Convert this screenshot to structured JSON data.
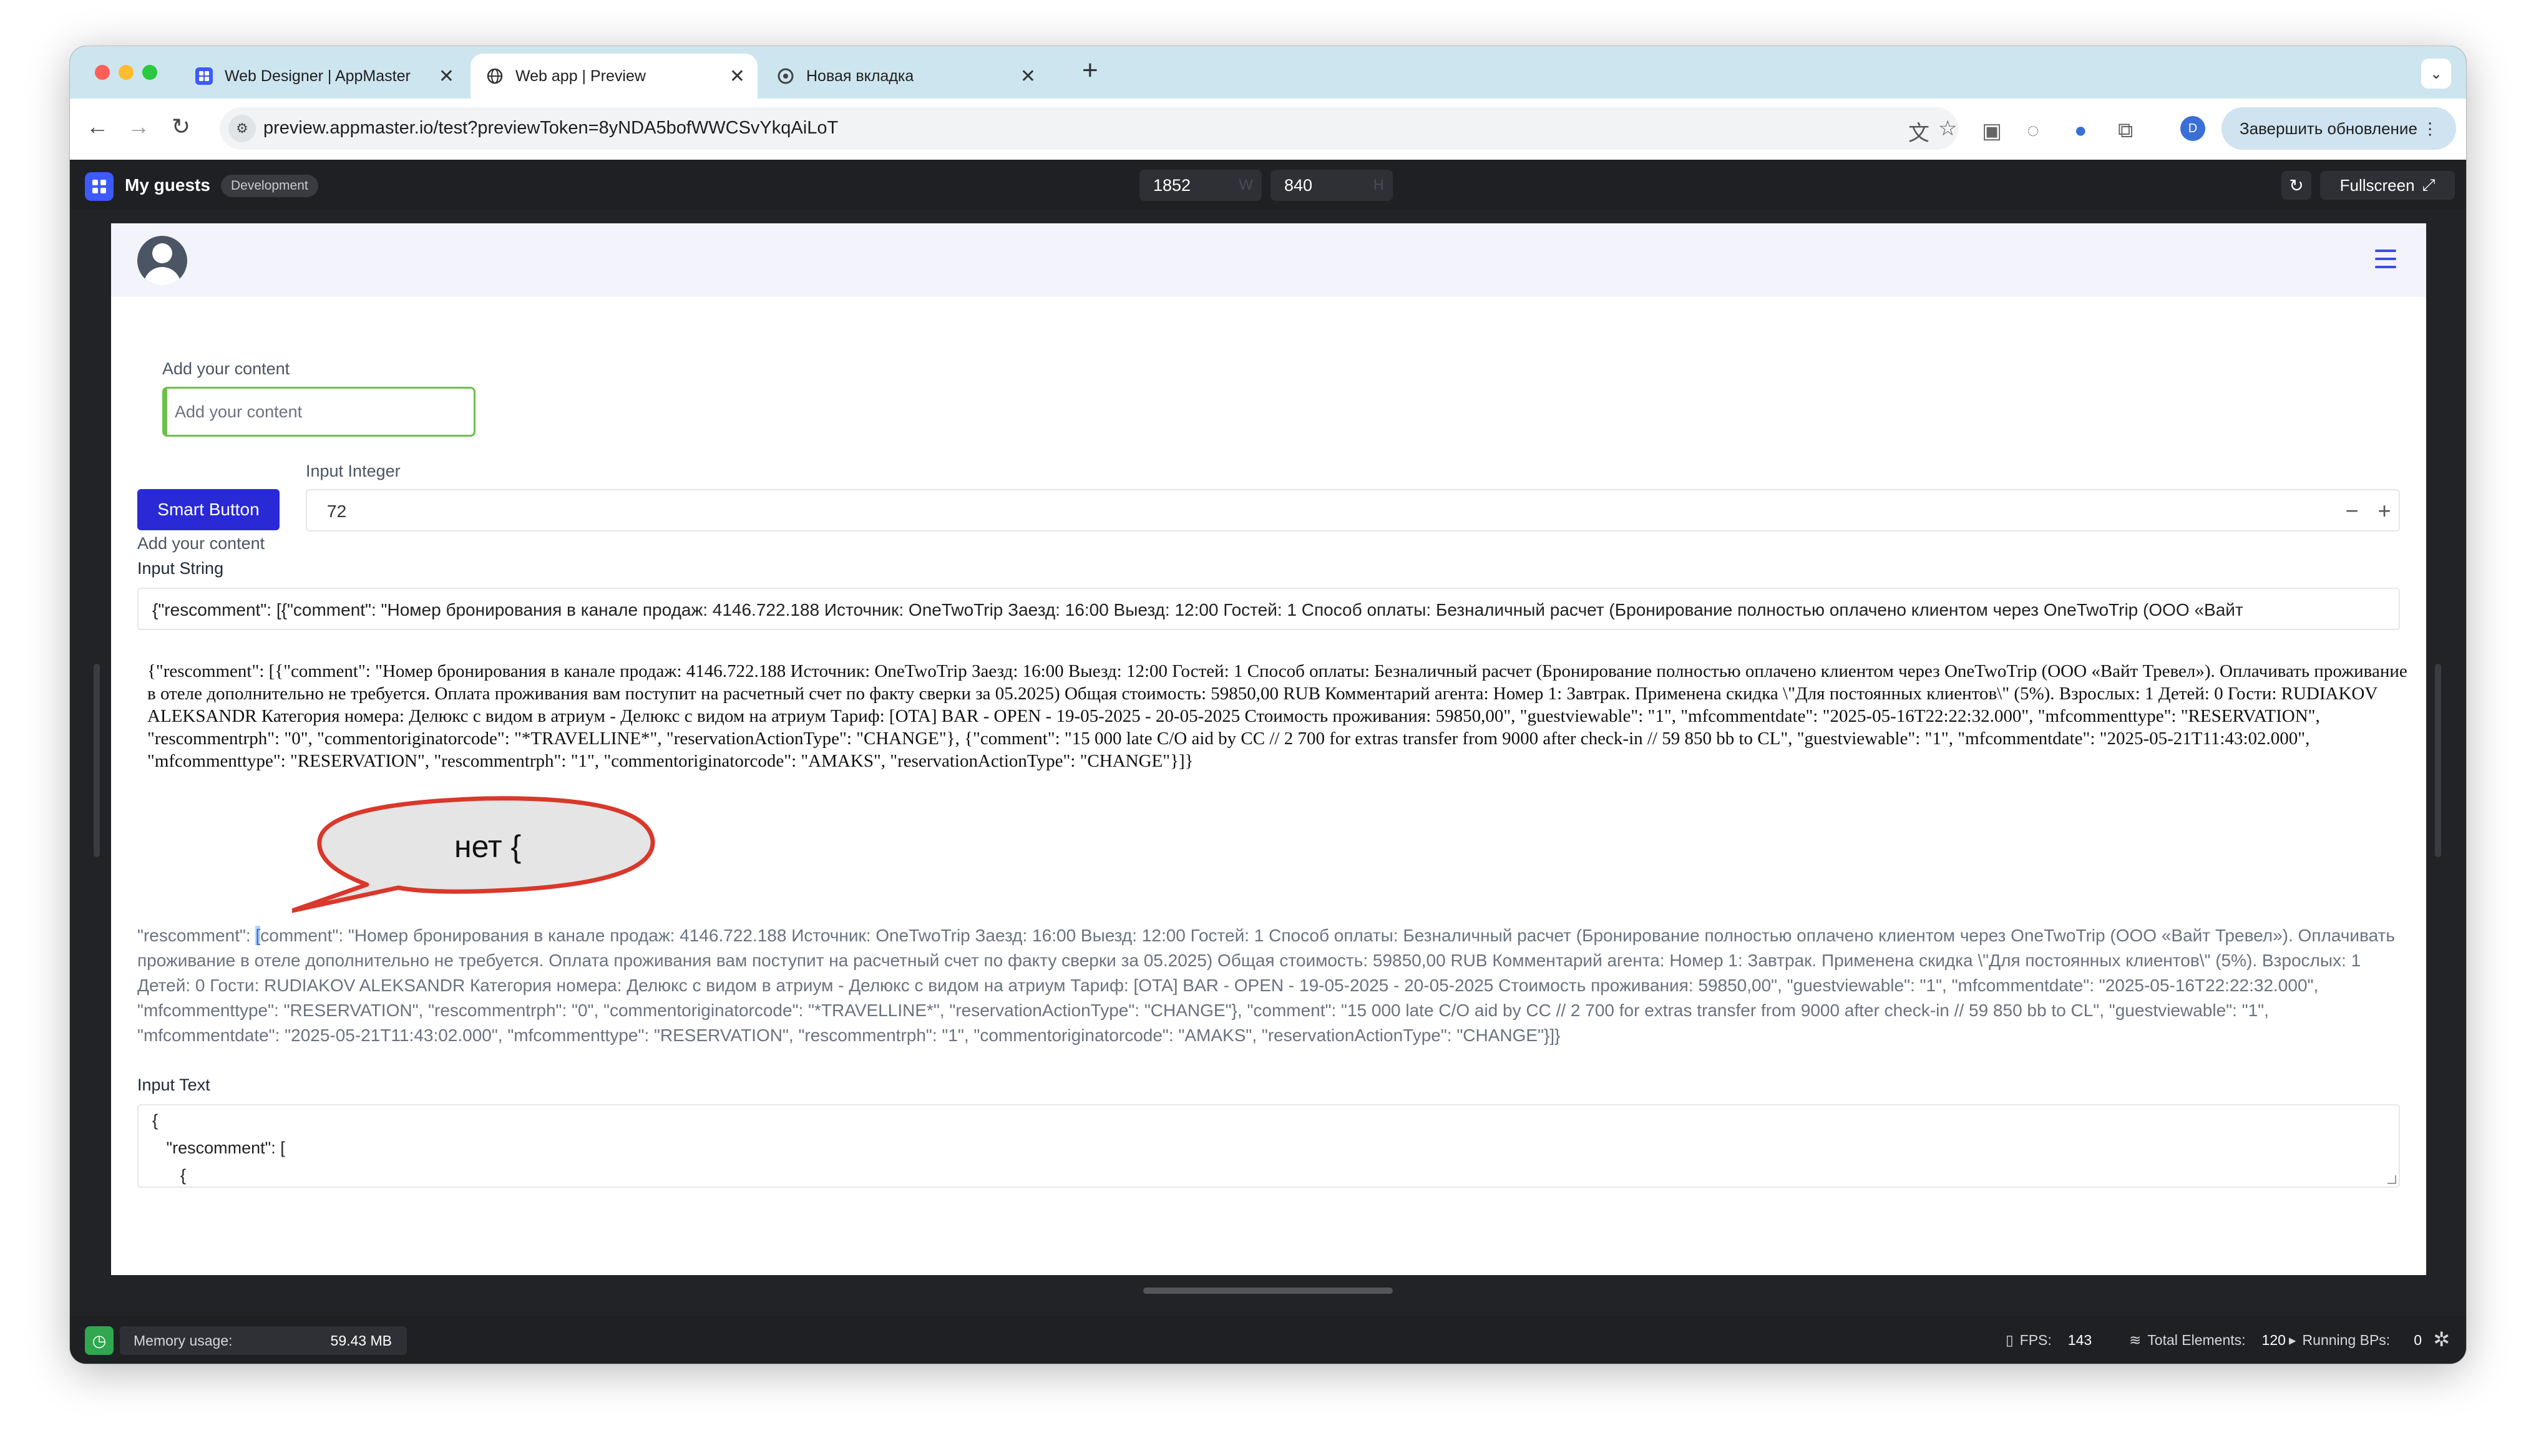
{
  "browser": {
    "tabs": [
      {
        "title": "Web Designer | AppMaster",
        "close": "✕"
      },
      {
        "title": "Web app | Preview",
        "close": "✕"
      },
      {
        "title": "Новая вкладка",
        "close": "✕"
      }
    ],
    "new_tab": "+",
    "url": "preview.appmaster.io/test?previewToken=8yNDA5bofWWCSvYkqAiLoT",
    "profile_initial": "D",
    "update_button": "Завершить обновление ⋮"
  },
  "preview_bar": {
    "app_name": "My guests",
    "env_badge": "Development",
    "width_value": "1852",
    "width_unit": "W",
    "height_value": "840",
    "height_unit": "H",
    "fullscreen_label": "Fullscreen"
  },
  "page": {
    "content_label": "Add your content",
    "content_placeholder": "Add your content",
    "smart_button": "Smart Button",
    "smart_caption": "Add your content",
    "input_integer_label": "Input Integer",
    "input_integer_value": "72",
    "stepper_minus": "−",
    "stepper_plus": "+",
    "input_string_label": "Input String",
    "input_string_value": "{\"rescomment\": [{\"comment\": \"Номер бронирования в канале продаж: 4146.722.188 Источник: OneTwoTrip Заезд: 16:00 Выезд: 12:00 Гостей: 1 Способ оплаты: Безналичный расчет (Бронирование полностью оплачено клиентом через OneTwoTrip (ООО «Вайт",
    "serif_text": "{\"rescomment\": [{\"comment\": \"Номер бронирования в канале продаж: 4146.722.188 Источник: OneTwoTrip Заезд: 16:00 Выезд: 12:00 Гостей: 1 Способ оплаты: Безналичный расчет (Бронирование полностью оплачено клиентом через OneTwoTrip (ООО «Вайт Тревел»). Оплачивать проживание в отеле дополнительно не требуется. Оплата проживания вам поступит на расчетный счет по факту сверки за 05.2025) Общая стоимость: 59850,00 RUB Комментарий агента: Номер 1: Завтрак. Применена скидка \\\"Для постоянных клиентов\\\" (5%). Взрослых: 1 Детей: 0 Гости: RUDIAKOV ALEKSANDR Категория номера: Делюкс с видом в атриум - Делюкс с видом на атриум Тариф: [OTA] BAR - OPEN - 19-05-2025 - 20-05-2025 Стоимость проживания: 59850,00\", \"guestviewable\": \"1\", \"mfcommentdate\": \"2025-05-16T22:22:32.000\", \"mfcommenttype\": \"RESERVATION\", \"rescommentrph\": \"0\", \"commentoriginatorcode\": \"*TRAVELLINE*\", \"reservationActionType\": \"CHANGE\"}, {\"comment\": \"15 000 late C/O aid by CC // 2 700 for extras transfer from 9000 after check-in // 59 850 bb to CL\", \"guestviewable\": \"1\", \"mfcommentdate\": \"2025-05-21T11:43:02.000\", \"mfcommenttype\": \"RESERVATION\", \"rescommentrph\": \"1\", \"commentoriginatorcode\": \"AMAKS\", \"reservationActionType\": \"CHANGE\"}]}",
    "callout_text": "нет {",
    "plain_text_prefix": "\"rescomment\": ",
    "plain_text_caret": "[",
    "plain_text_rest": "comment\": \"Номер бронирования в канале продаж: 4146.722.188 Источник: OneTwoTrip Заезд: 16:00 Выезд: 12:00 Гостей: 1 Способ оплаты: Безналичный расчет (Бронирование полностью оплачено клиентом через OneTwoTrip (ООО «Вайт Тревел»). Оплачивать проживание в отеле дополнительно не требуется. Оплата проживания вам поступит на расчетный счет по факту сверки за 05.2025) Общая стоимость: 59850,00 RUB Комментарий агента: Номер 1: Завтрак. Применена скидка \\\"Для постоянных клиентов\\\" (5%). Взрослых: 1 Детей: 0 Гости: RUDIAKOV ALEKSANDR Категория номера: Делюкс с видом в атриум - Делюкс с видом на атриум Тариф: [OTA] BAR - OPEN - 19-05-2025 - 20-05-2025 Стоимость проживания: 59850,00\", \"guestviewable\": \"1\", \"mfcommentdate\": \"2025-05-16T22:22:32.000\", \"mfcommenttype\": \"RESERVATION\", \"rescommentrph\": \"0\", \"commentoriginatorcode\": \"*TRAVELLINE*\", \"reservationActionType\": \"CHANGE\"}, \"comment\": \"15 000 late C/O aid by CC // 2 700 for extras transfer from 9000 after check-in // 59 850 bb to CL\", \"guestviewable\": \"1\", \"mfcommentdate\": \"2025-05-21T11:43:02.000\", \"mfcommenttype\": \"RESERVATION\", \"rescommentrph\": \"1\", \"commentoriginatorcode\": \"AMAKS\", \"reservationActionType\": \"CHANGE\"}]}",
    "input_text_label": "Input Text",
    "input_text_value": "{\n   \"rescomment\": [\n      {"
  },
  "status_bar": {
    "memory_label": "Memory usage:",
    "memory_value": "59.43 MB",
    "fps_label": "FPS:",
    "fps_value": "143",
    "elements_label": "Total Elements:",
    "elements_value": "120",
    "bps_label": "Running BPs:",
    "bps_value": "0"
  },
  "colors": {
    "accent": "#2929d6",
    "tab_strip": "#cde5ef",
    "input_border_active": "#6bc04b",
    "callout_stroke": "#d9382b",
    "callout_fill": "#e5e5e5"
  },
  "icons": {
    "back": "back-arrow-icon",
    "forward": "forward-arrow-icon",
    "reload": "reload-icon",
    "translate": "translate-icon",
    "bookmark": "star-icon",
    "hamburger": "hamburger-menu-icon",
    "avatar": "user-avatar-icon"
  }
}
